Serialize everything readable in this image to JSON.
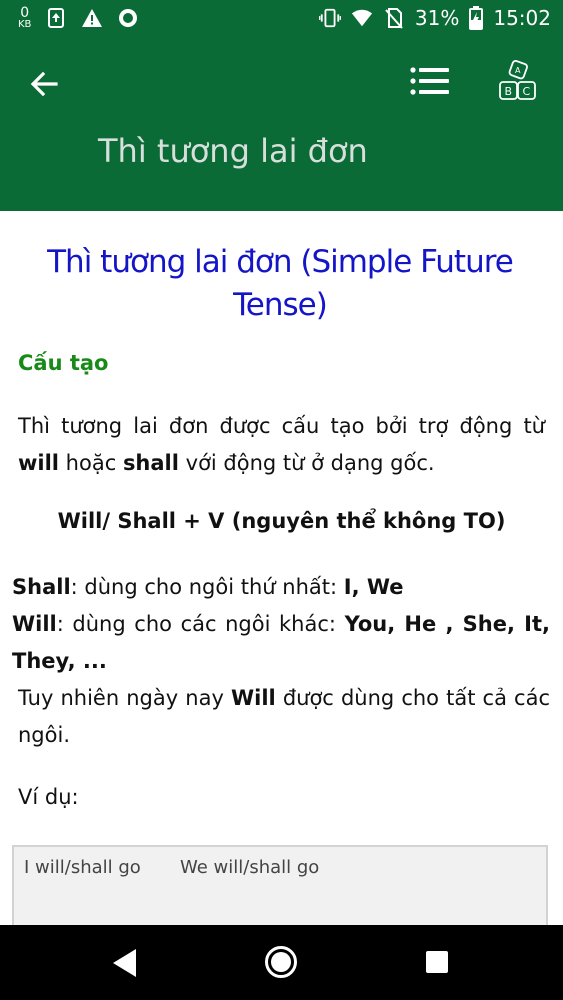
{
  "status_bar": {
    "data_speed_value": "0",
    "data_speed_unit": "KB",
    "battery_percent": "31%",
    "time": "15:02"
  },
  "app_bar": {
    "title": "Thì tương lai đơn",
    "icons": [
      "back-arrow-icon",
      "list-icon",
      "abc-blocks-icon"
    ]
  },
  "article": {
    "title": "Thì tương lai đơn (Simple Future Tense)",
    "section_heading": "Cấu tạo",
    "para1": {
      "part1": "Thì tương lai đơn được cấu tạo bởi trợ động từ ",
      "will": "will",
      "part2": " hoặc ",
      "shall": "shall",
      "part3": " với động từ ở dạng gốc."
    },
    "formula": "Will/ Shall + V (nguyên thể không TO)",
    "shall_rule": {
      "keyword": "Shall",
      "text": ": dùng cho ngôi thứ nhất: ",
      "pronouns": "I, We"
    },
    "will_rule": {
      "keyword": "Will",
      "text": ": dùng cho các ngôi khác: ",
      "pronouns": "You, He , She, It, They, ..."
    },
    "note": {
      "part1": "Tuy nhiên ngày nay ",
      "will": "Will",
      "part2": " được dùng cho tất cả các ngôi."
    },
    "example_label": "Ví dụ:",
    "examples": [
      "I will/shall go",
      "We will/shall go"
    ]
  }
}
